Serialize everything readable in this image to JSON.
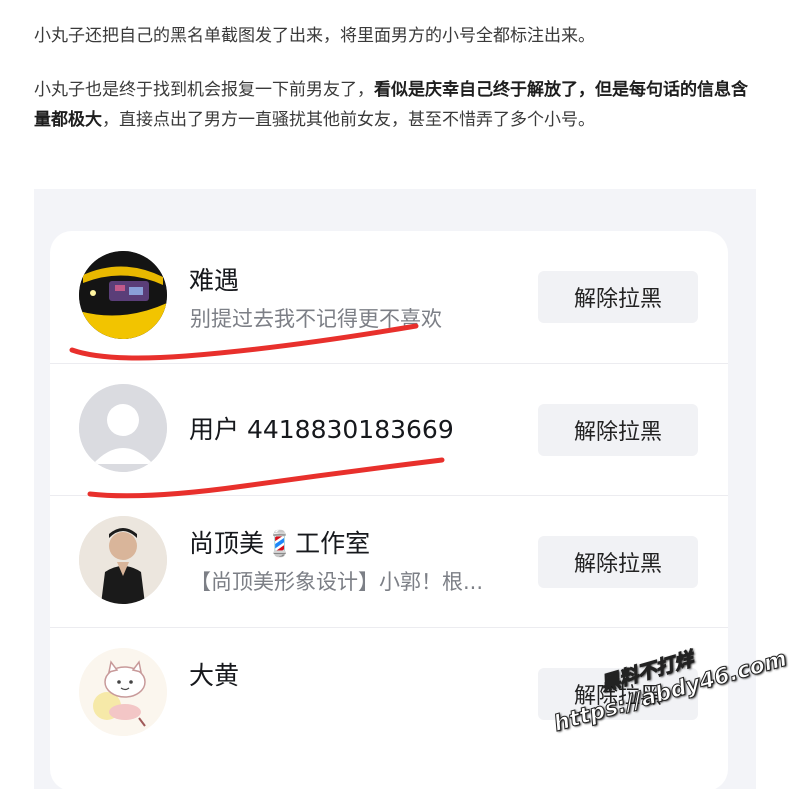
{
  "article": {
    "para1": "小丸子还把自己的黑名单截图发了出来，将里面男方的小号全都标注出来。",
    "para2_start": "小丸子也是终于找到机会报复一下前男友了，",
    "para2_bold": "看似是庆幸自己终于解放了，但是每句话的信息含量都极大",
    "para2_end": "，直接点出了男方一直骚扰其他前女友，甚至不惜弄了多个小号。"
  },
  "blacklist": {
    "button_label": "解除拉黑",
    "users": [
      {
        "name": "难遇",
        "subtitle": "别提过去我不记得更不喜欢"
      },
      {
        "name": "用户 4418830183669",
        "subtitle": ""
      },
      {
        "name": "尚顶美💈工作室",
        "subtitle": "【尚顶美形象设计】小郭！根..."
      },
      {
        "name": "大黄",
        "subtitle": ""
      }
    ]
  },
  "watermark": {
    "line1": "黑料不打烊",
    "line2": "https://abdy46.com"
  },
  "colors": {
    "underline": "#e8302c",
    "button_bg": "#f1f2f5",
    "screenshot_bg": "#f3f4f8"
  }
}
